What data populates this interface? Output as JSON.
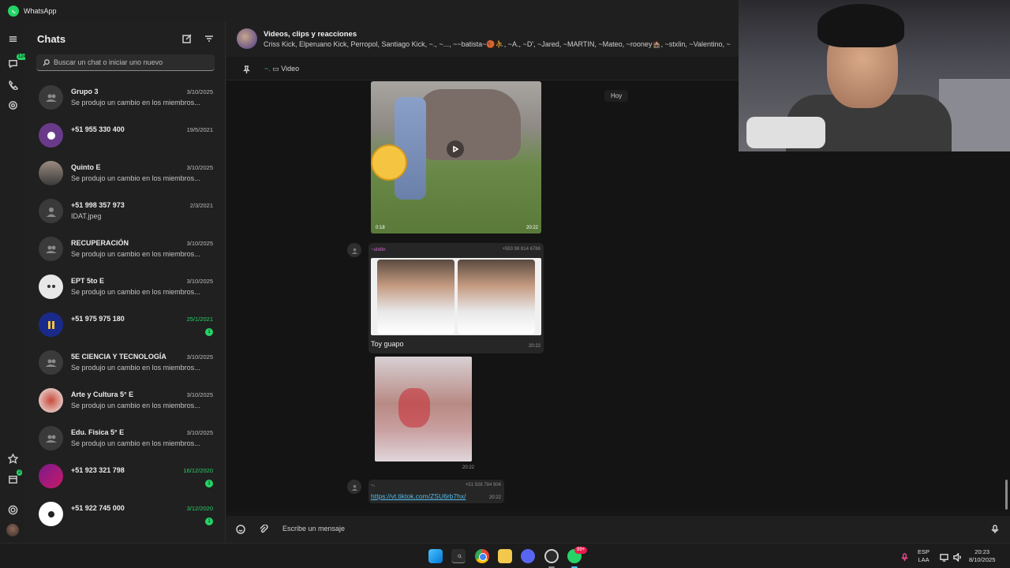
{
  "titlebar": {
    "app_name": "WhatsApp"
  },
  "rail": {
    "chats_badge": "124",
    "status_badge": "2"
  },
  "sidebar": {
    "title": "Chats",
    "search_placeholder": "Buscar un chat o iniciar uno nuevo",
    "chats": [
      {
        "name": "Grupo 3",
        "date": "3/10/2025",
        "preview": "Se produjo un cambio en los miembros...",
        "unread": ""
      },
      {
        "name": "+51 955 330 400",
        "date": "19/5/2021",
        "preview": "",
        "unread": ""
      },
      {
        "name": "Quinto E",
        "date": "3/10/2025",
        "preview": "Se produjo un cambio en los miembros...",
        "unread": ""
      },
      {
        "name": "+51 998 357 973",
        "date": "2/3/2021",
        "preview": "IDAT.jpeg",
        "unread": ""
      },
      {
        "name": "RECUPERACIÓN",
        "date": "3/10/2025",
        "preview": "Se produjo un cambio en los miembros...",
        "unread": ""
      },
      {
        "name": "EPT 5to E",
        "date": "3/10/2025",
        "preview": "Se produjo un cambio en los miembros...",
        "unread": ""
      },
      {
        "name": "+51 975 975 180",
        "date": "25/1/2021",
        "preview": "",
        "unread": "1"
      },
      {
        "name": "5E CIENCIA Y TECNOLOGÍA",
        "date": "3/10/2025",
        "preview": "Se produjo un cambio en los miembros...",
        "unread": ""
      },
      {
        "name": "Arte y Cultura 5° E",
        "date": "3/10/2025",
        "preview": "Se produjo un cambio en los miembros...",
        "unread": ""
      },
      {
        "name": "Edu. Fisica 5° E",
        "date": "3/10/2025",
        "preview": "Se produjo un cambio en los miembros...",
        "unread": ""
      },
      {
        "name": "+51 923 321 798",
        "date": "16/12/2020",
        "preview": "",
        "unread": "1"
      },
      {
        "name": "+51 922 745 000",
        "date": "3/12/2020",
        "preview": "",
        "unread": "1"
      }
    ]
  },
  "conversation": {
    "title": "Videos, clips y reacciones",
    "members": "Criss Kick, Elperuano Kick, Perropol, Santiago Kick, ~., ~..., ~~batista~🏀⛹️, ~A., ~D', ~Jared, ~MARTIN, ~Mateo, ~rooney🏚️, ~stxlin, ~Valentino, ~",
    "pinned_prefix": "~.",
    "pinned_label": "Video",
    "date_chip": "Hoy",
    "messages": {
      "video_duration": "0:18",
      "video_time": "20:22",
      "image_sender": "~stxlin",
      "image_sender_phone": "+593 98 814 6788",
      "image_caption": "Toy guapo",
      "image_time": "20:22",
      "image2_time": "20:22",
      "link_sender": "~.",
      "link_sender_phone": "+51 928 784 904",
      "link_url": "https://vt.tiktok.com/ZSU6rb7hx/",
      "link_time": "20:22"
    },
    "composer_placeholder": "Escribe un mensaje"
  },
  "taskbar": {
    "whatsapp_badge": "99+",
    "lang_top": "ESP",
    "lang_bottom": "LAA",
    "time": "20:23",
    "date": "8/10/2025"
  }
}
